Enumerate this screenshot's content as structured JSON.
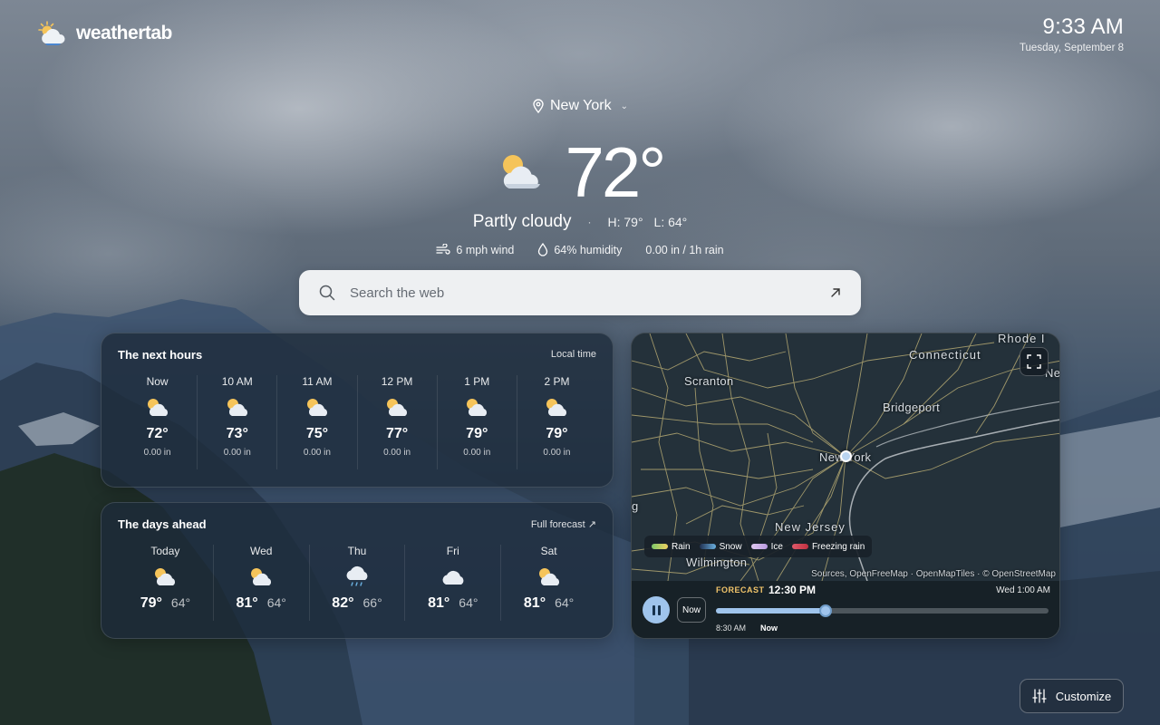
{
  "brand": {
    "name": "weathertab"
  },
  "clock": {
    "time": "9:33 AM",
    "date": "Tuesday, September 8"
  },
  "location": {
    "name": "New York",
    "icon": "map-pin-icon"
  },
  "current": {
    "temperature": "72°",
    "condition": "Partly cloudy",
    "separator": "·",
    "high": "H: 79°",
    "low": "L: 64°",
    "icon": "partly-cloudy-icon"
  },
  "metrics": {
    "wind": "6 mph wind",
    "humidity": "64% humidity",
    "rain": "0.00 in / 1h rain"
  },
  "search": {
    "placeholder": "Search the web"
  },
  "hours": {
    "title": "The next hours",
    "link": "Local time",
    "items": [
      {
        "label": "Now",
        "temp": "72°",
        "precip": "0.00 in",
        "icon": "partly-cloudy-icon"
      },
      {
        "label": "10 AM",
        "temp": "73°",
        "precip": "0.00 in",
        "icon": "partly-cloudy-icon"
      },
      {
        "label": "11 AM",
        "temp": "75°",
        "precip": "0.00 in",
        "icon": "partly-cloudy-icon"
      },
      {
        "label": "12 PM",
        "temp": "77°",
        "precip": "0.00 in",
        "icon": "partly-cloudy-icon"
      },
      {
        "label": "1 PM",
        "temp": "79°",
        "precip": "0.00 in",
        "icon": "partly-cloudy-icon"
      },
      {
        "label": "2 PM",
        "temp": "79°",
        "precip": "0.00 in",
        "icon": "partly-cloudy-icon"
      }
    ]
  },
  "days": {
    "title": "The days ahead",
    "link": "Full forecast ↗",
    "items": [
      {
        "label": "Today",
        "high": "79°",
        "low": "64°",
        "icon": "partly-cloudy-icon"
      },
      {
        "label": "Wed",
        "high": "81°",
        "low": "64°",
        "icon": "partly-cloudy-icon"
      },
      {
        "label": "Thu",
        "high": "82°",
        "low": "66°",
        "icon": "rain-cloud-icon"
      },
      {
        "label": "Fri",
        "high": "81°",
        "low": "64°",
        "icon": "cloud-icon"
      },
      {
        "label": "Sat",
        "high": "81°",
        "low": "64°",
        "icon": "partly-cloudy-icon"
      }
    ]
  },
  "map": {
    "labels": {
      "scranton": "Scranton",
      "connecticut": "Connecticut",
      "rhode": "Rhode I",
      "bridgeport": "Bridgeport",
      "newyork": "New York",
      "newjersey": "New Jersey",
      "wilmington": "Wilmington",
      "ne": "Ne",
      "g": "g"
    },
    "legend": [
      {
        "label": "Rain",
        "color": "#7cc86a"
      },
      {
        "label": "Snow",
        "color": "#6ab0e0"
      },
      {
        "label": "Ice",
        "color": "#b99ae0"
      },
      {
        "label": "Freezing rain",
        "color": "#e05a6a"
      }
    ],
    "attribution": "Sources, OpenFreeMap · OpenMapTiles · © OpenStreetMap",
    "player": {
      "now_label": "Now",
      "forecast_tag": "FORECAST",
      "forecast_time": "12:30 PM",
      "end_time": "Wed 1:00 AM",
      "start_time": "8:30 AM",
      "now_tick": "Now",
      "progress": 0.33
    }
  },
  "customize": {
    "label": "Customize"
  }
}
